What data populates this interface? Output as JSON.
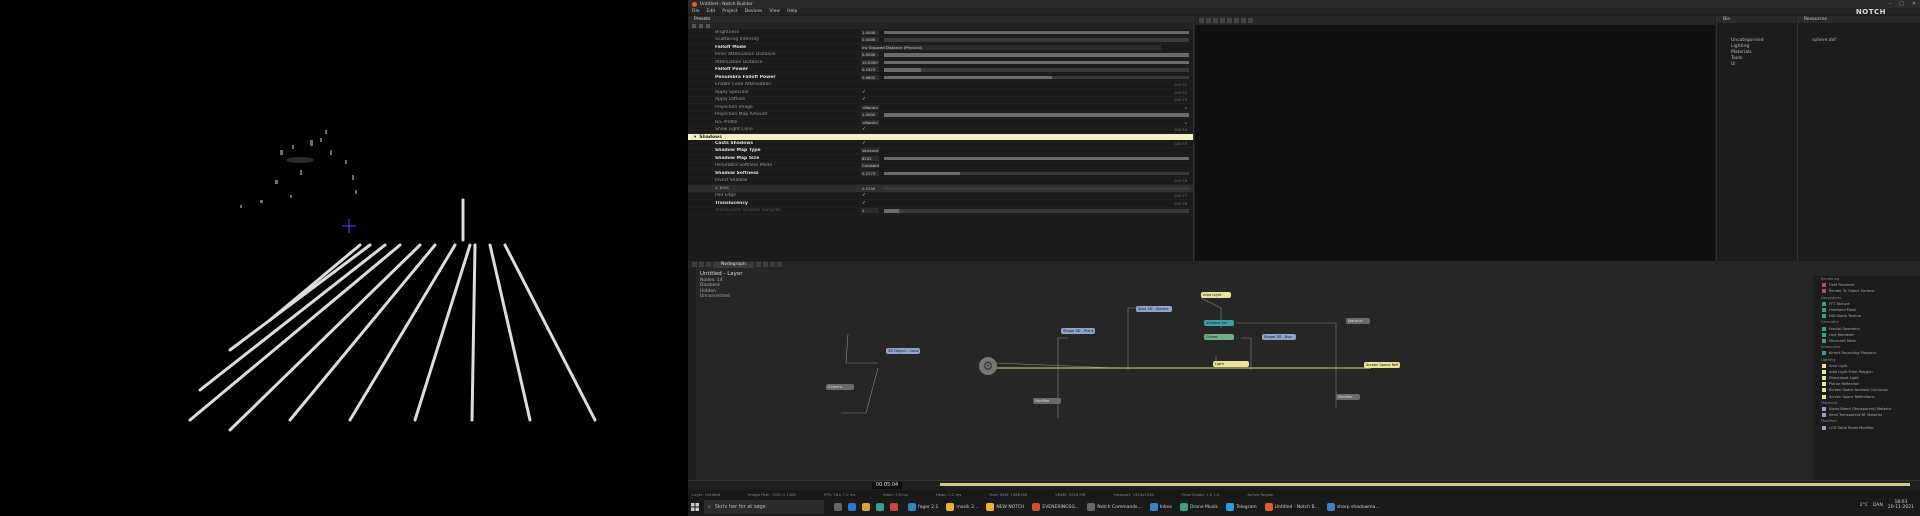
{
  "window": {
    "title": "Untitled - Notch Builder"
  },
  "menu": [
    "File",
    "Edit",
    "Project",
    "Devices",
    "View",
    "Help"
  ],
  "brand": "NOTCH",
  "properties": {
    "header": "Presets",
    "rows": [
      {
        "name": "Brightness",
        "value": "1.0000",
        "slider": 100
      },
      {
        "name": "Scattering Intensity",
        "value": "0.0000",
        "slider": 0
      },
      {
        "name": "Falloff Mode",
        "value": "Inv Squared Distance (Physical)",
        "wide": true,
        "bold": true
      },
      {
        "name": "Inner Attenuation Distance",
        "value": "0.0000",
        "slider": 100
      },
      {
        "name": "Attenuation Distance",
        "value": "10.0000",
        "slider": 100
      },
      {
        "name": "Falloff Power",
        "value": "0.1923",
        "slider": 12,
        "bold": true
      },
      {
        "name": "Penumbra Falloff Power",
        "value": "0.9602",
        "slider": 55,
        "bold": true
      },
      {
        "name": "Enable Cone Attenuation",
        "short": "Ctrl F1"
      },
      {
        "name": "Apply Specular",
        "check": "✓",
        "short": "Ctrl F2"
      },
      {
        "name": "Apply Diffuse",
        "check": "✓",
        "short": "Ctrl F3"
      },
      {
        "name": "Projection Image",
        "value": "<None>",
        "short": "▸"
      },
      {
        "name": "Projection Map Amount",
        "value": "1.0000",
        "slider": 100
      },
      {
        "name": "IES Profile",
        "value": "<None>",
        "short": "▸"
      },
      {
        "name": "Show Light Cone",
        "check": "✓",
        "short": "Ctrl F4"
      }
    ],
    "section": "Shadows",
    "shadow_rows": [
      {
        "name": "Casts Shadows",
        "check": "✓",
        "short": "Ctrl F5",
        "bold": true
      },
      {
        "name": "Shadow Map Type",
        "value": "Variance Soft",
        "bold": true
      },
      {
        "name": "Shadow Map Size",
        "value": "8192",
        "slider": 100,
        "bold": true
      },
      {
        "name": "Penumbra Softness Mode",
        "value": "Constant"
      },
      {
        "name": "Shadow Softness",
        "value": "0.2773",
        "slider": 25,
        "bold": true
      },
      {
        "name": "Invert Shadow",
        "short": "Ctrl F6"
      },
      {
        "name": "Z Bias",
        "value": "0.0100",
        "slider": 0,
        "sel": true
      },
      {
        "name": "Pad Edge",
        "check": "✓",
        "short": "Ctrl F7"
      },
      {
        "name": "Translucency",
        "check": "✓",
        "short": "Ctrl F8",
        "bold": true
      },
      {
        "name": "Translucent Shadow Samples",
        "value": "1",
        "slider": 5,
        "dim": true
      }
    ]
  },
  "bins": {
    "title": "Bin",
    "items": [
      "Uncategorised",
      "Lighting",
      "Materials",
      "Tools",
      "Ui"
    ]
  },
  "resources": {
    "title": "Resources",
    "item": "sphere.dxf"
  },
  "nodegraph": {
    "tab": "Nodegraph",
    "layer_title": "Untitled - Layer",
    "stats": [
      "Nodes: 14",
      "Disabled",
      "Hidden",
      "Unconnected"
    ],
    "nodes": [
      {
        "label": "Area Light",
        "color": "yellow"
      },
      {
        "label": "Shadow Vol",
        "color": "teal"
      },
      {
        "label": "3D Object - Cone",
        "color": "blue"
      },
      {
        "label": "Spot 3D - Sphere",
        "color": "blue"
      },
      {
        "label": "Shape 3D - Plane",
        "color": "blue"
      },
      {
        "label": "Shape 3D - Box",
        "color": "blue"
      },
      {
        "label": "Cloner",
        "color": "green"
      },
      {
        "label": "Light",
        "color": "yellow"
      },
      {
        "label": "Screen Space Refl",
        "color": "yellow"
      },
      {
        "label": "Camera",
        "color": "gray"
      },
      {
        "label": "Modifier",
        "color": "gray"
      },
      {
        "label": "Modifier",
        "color": "gray"
      },
      {
        "label": "Material",
        "color": "gray"
      }
    ]
  },
  "palette": {
    "items": [
      {
        "type": "cat",
        "label": "Rendering"
      },
      {
        "type": "item",
        "label": "Field Renderer",
        "color": "#b44a7a"
      },
      {
        "type": "item",
        "label": "Render To Object Surface",
        "color": "#b44a7a"
      },
      {
        "type": "cat",
        "label": "Generators"
      },
      {
        "type": "item",
        "label": "FFT Texture",
        "color": "#3aa18a"
      },
      {
        "type": "item",
        "label": "Freehand Mask",
        "color": "#3aa18a"
      },
      {
        "type": "item",
        "label": "NDI Alpha Texture",
        "color": "#3aa18a"
      },
      {
        "type": "cat",
        "label": "Geometry"
      },
      {
        "type": "item",
        "label": "Fractal Geometry",
        "color": "#3aa18a"
      },
      {
        "type": "item",
        "label": "Line Renderer",
        "color": "#3aa18a"
      },
      {
        "type": "item",
        "label": "Minecraft Mesh",
        "color": "#3aa18a"
      },
      {
        "type": "cat",
        "label": "Interactive"
      },
      {
        "type": "item",
        "label": "Kinect Recording Playback",
        "color": "#3aa18a"
      },
      {
        "type": "cat",
        "label": "Lighting"
      },
      {
        "type": "item",
        "label": "Area Light",
        "color": "#e8e49a"
      },
      {
        "type": "item",
        "label": "Area Light From Polygon",
        "color": "#e8e49a"
      },
      {
        "type": "item",
        "label": "Directional Light",
        "color": "#e8e49a"
      },
      {
        "type": "item",
        "label": "Planar Reflection",
        "color": "#e8e49a"
      },
      {
        "type": "item",
        "label": "Screen Space Ambient Occlusion",
        "color": "#e8e49a"
      },
      {
        "type": "item",
        "label": "Screen Space Reflections",
        "color": "#e8e49a"
      },
      {
        "type": "cat",
        "label": "Materials"
      },
      {
        "type": "item",
        "label": "Alpha Blend (Transparent) Material",
        "color": "#8fa4c8"
      },
      {
        "type": "item",
        "label": "Semi Transparent BF Material",
        "color": "#8fa4c8"
      },
      {
        "type": "cat",
        "label": "Modifiers"
      },
      {
        "type": "item",
        "label": "LOD Table Reset Modifier",
        "color": "#8fa4c8"
      }
    ]
  },
  "timeline": {
    "time": "00:05:04"
  },
  "status": [
    "Layer: Untitled",
    "Image Path: 1920 x 1080",
    "FPS: 58 ▸ 7.0 ms",
    "Main: 7.0 ms",
    "Heap: 0.2 ms",
    "Main RAM: 1068 MB",
    "VRAM: 2018 MB",
    "Viewport: 1920x1080",
    "Final Grade: 1.0 1.0",
    "Active Region"
  ],
  "taskbar": {
    "search_placeholder": "Skriv her for at søge",
    "items": [
      {
        "label": "fager 2.1",
        "color": "#3b82c4"
      },
      {
        "label": "mosik 2...",
        "color": "#f0b429"
      },
      {
        "label": "NEW NOTCH",
        "color": "#f0b429"
      },
      {
        "label": "EVENERINGSG...",
        "color": "#d0502a"
      },
      {
        "label": "Notch Commands...",
        "color": "#666"
      },
      {
        "label": "Inbox",
        "color": "#3b82c4"
      },
      {
        "label": "Drone Musik",
        "color": "#3aa18a"
      },
      {
        "label": "Telegram",
        "color": "#2aa1d8"
      },
      {
        "label": "Untitled - Notch B...",
        "color": "#e55a2b"
      },
      {
        "label": "sharp shadowma...",
        "color": "#3b82c4"
      }
    ],
    "weather": "2°C",
    "lang": "DAN",
    "time": "18:03",
    "date": "20-11-2021"
  }
}
